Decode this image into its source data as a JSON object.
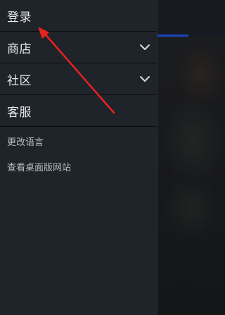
{
  "drawer": {
    "items": [
      {
        "label": "登录",
        "has_chevron": false
      },
      {
        "label": "商店",
        "has_chevron": true
      },
      {
        "label": "社区",
        "has_chevron": true
      },
      {
        "label": "客服",
        "has_chevron": false
      }
    ],
    "links": [
      {
        "label": "更改语言"
      },
      {
        "label": "查看桌面版网站"
      }
    ]
  },
  "colors": {
    "drawer_bg": "#1f232a",
    "text_primary": "#e6e8eb",
    "text_secondary": "#b8bcc2",
    "accent": "#1a44c2",
    "annotation_arrow": "#e8231f"
  },
  "annotation": {
    "icon": "red-arrow-pointing-to-login"
  }
}
